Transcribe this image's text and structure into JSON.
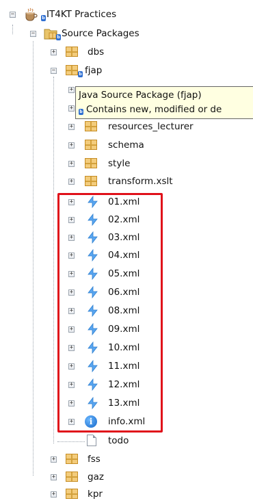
{
  "project": {
    "name": "IT4KT Practices"
  },
  "source_packages": {
    "label": "Source Packages"
  },
  "packages": {
    "dbs": "dbs",
    "fjap": "fjap",
    "resources_lecturer": "resources_lecturer",
    "schema": "schema",
    "style": "style",
    "transform": "transform.xslt",
    "fss": "fss",
    "gaz": "gaz",
    "kpr": "kpr"
  },
  "files": {
    "xml": [
      "01.xml",
      "02.xml",
      "03.xml",
      "04.xml",
      "05.xml",
      "06.xml",
      "08.xml",
      "09.xml",
      "10.xml",
      "11.xml",
      "12.xml",
      "13.xml"
    ],
    "info": "info.xml",
    "todo": "todo"
  },
  "tooltip": {
    "title": "Java Source Package (fjap)",
    "status": "Contains new, modified or de"
  },
  "icons": {
    "project": "coffee-cup-project-icon",
    "package": "package-icon",
    "xml": "xml-file-icon",
    "info": "info-icon",
    "text": "text-file-icon",
    "modified_badge": "modified-badge-icon"
  },
  "colors": {
    "highlight_box": "#e0101a",
    "tooltip_bg": "#ffffe1"
  }
}
